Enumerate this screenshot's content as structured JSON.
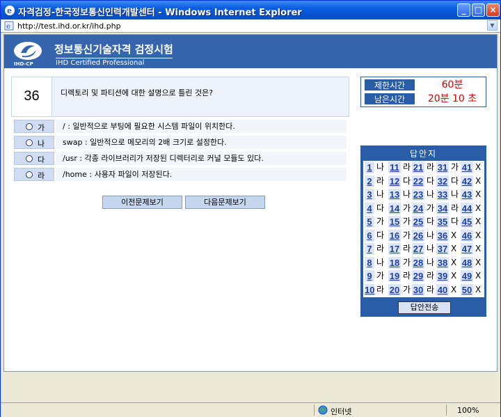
{
  "window": {
    "title": "자격검정-한국정보통신인력개발센터 - Windows Internet Explorer"
  },
  "address": {
    "url": "http://test.ihd.or.kr/ihd.php"
  },
  "header": {
    "title": "정보통신기술자격 검정시험",
    "subtitle": "IHD Certified Professional",
    "logo_text": "IHD-CP"
  },
  "question": {
    "number": "36",
    "text": "디렉토리 및 파티션에 대한 설명으로 틀린 것은?"
  },
  "options": [
    {
      "letter": "가",
      "text": "/ : 일반적으로 부팅에 필요한 시스템 파일이 위치한다."
    },
    {
      "letter": "나",
      "text": "swap : 일반적으로 메모리의 2배 크기로 설정한다."
    },
    {
      "letter": "다",
      "text": "/usr : 각종 라이브러리가 저장된 디렉터리로 커널 모듈도 있다."
    },
    {
      "letter": "라",
      "text": "/home : 사용자 파일이 저장된다."
    }
  ],
  "nav": {
    "prev": "이전문제보기",
    "next": "다음문제보기"
  },
  "timer": {
    "limit_label": "제한시간",
    "limit_value": "60분",
    "remain_label": "남은시간",
    "remain_value": "20분 10 초"
  },
  "answers": {
    "title": "답안지",
    "items": [
      [
        "1",
        "나"
      ],
      [
        "11",
        "라"
      ],
      [
        "21",
        "라"
      ],
      [
        "31",
        "가"
      ],
      [
        "41",
        "X"
      ],
      [
        "2",
        "라"
      ],
      [
        "12",
        "다"
      ],
      [
        "22",
        "다"
      ],
      [
        "32",
        "다"
      ],
      [
        "42",
        "X"
      ],
      [
        "3",
        "나"
      ],
      [
        "13",
        "나"
      ],
      [
        "23",
        "나"
      ],
      [
        "33",
        "나"
      ],
      [
        "43",
        "X"
      ],
      [
        "4",
        "다"
      ],
      [
        "14",
        "가"
      ],
      [
        "24",
        "가"
      ],
      [
        "34",
        "라"
      ],
      [
        "44",
        "X"
      ],
      [
        "5",
        "가"
      ],
      [
        "15",
        "가"
      ],
      [
        "25",
        "다"
      ],
      [
        "35",
        "다"
      ],
      [
        "45",
        "X"
      ],
      [
        "6",
        "다"
      ],
      [
        "16",
        "가"
      ],
      [
        "26",
        "나"
      ],
      [
        "36",
        "X"
      ],
      [
        "46",
        "X"
      ],
      [
        "7",
        "라"
      ],
      [
        "17",
        "라"
      ],
      [
        "27",
        "나"
      ],
      [
        "37",
        "X"
      ],
      [
        "47",
        "X"
      ],
      [
        "8",
        "나"
      ],
      [
        "18",
        "가"
      ],
      [
        "28",
        "나"
      ],
      [
        "38",
        "X"
      ],
      [
        "48",
        "X"
      ],
      [
        "9",
        "가"
      ],
      [
        "19",
        "라"
      ],
      [
        "29",
        "라"
      ],
      [
        "39",
        "X"
      ],
      [
        "49",
        "X"
      ],
      [
        "10",
        "라"
      ],
      [
        "20",
        "가"
      ],
      [
        "30",
        "라"
      ],
      [
        "40",
        "X"
      ],
      [
        "50",
        "X"
      ]
    ],
    "submit": "답안전송"
  },
  "status": {
    "zone": "인터넷",
    "zoom": "100%"
  },
  "colors": {
    "header_blue": "#3566ad",
    "time_red": "#d30000",
    "link_blue": "#1a3fa8"
  }
}
